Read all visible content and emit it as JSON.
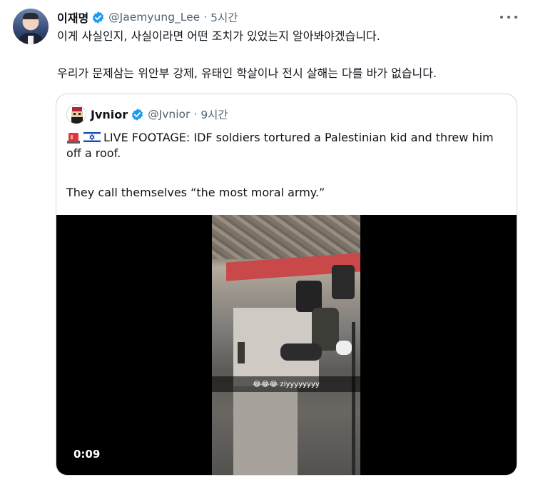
{
  "tweet": {
    "author_name": "이재명",
    "author_handle": "@Jaemyung_Lee",
    "separator": "·",
    "time": "5시간",
    "text_line1": "이게 사실인지, 사실이라면 어떤 조치가 있었는지 알아봐야겠습니다.",
    "text_line2": "우리가 문제삼는 위안부 강제, 유태인 학살이나 전시 살해는 다를 바가 없습니다.",
    "more_icon": "more-horizontal-icon"
  },
  "quoted_tweet": {
    "author_name": "Jvnior",
    "author_handle": "@Jvnior",
    "separator": "·",
    "time": "9시간",
    "emojis": [
      "siren-emoji",
      "israel-flag-emoji"
    ],
    "text_line1": "LIVE FOOTAGE: IDF soldiers tortured a Palestinian kid and threw him off a roof.",
    "text_line2": "They call themselves “the most moral army.”",
    "video": {
      "duration": "0:09",
      "caption": "😂😂😂 ziyyyyyyyy"
    }
  },
  "colors": {
    "text_primary": "#0f1419",
    "text_secondary": "#536471",
    "verified_blue": "#1d9bf0",
    "border": "#cfd9de"
  }
}
